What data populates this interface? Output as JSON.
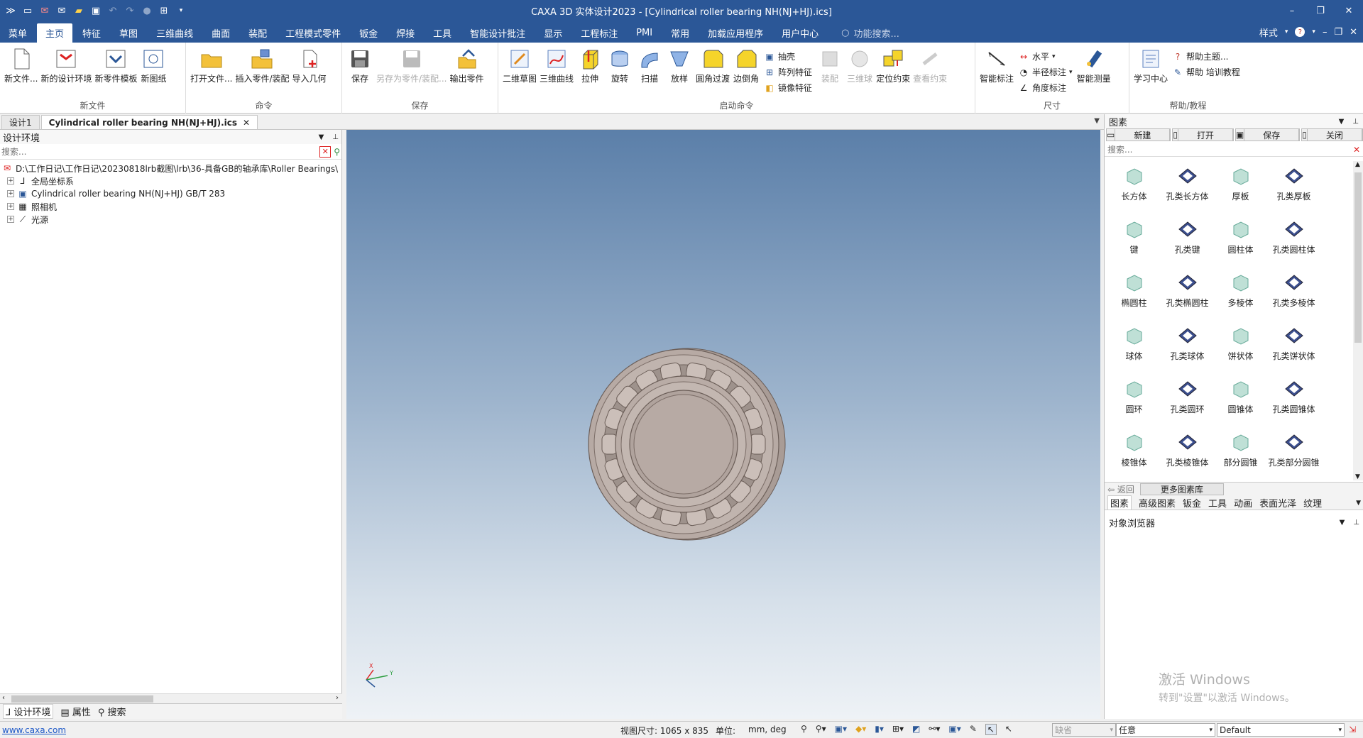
{
  "titlebar": {
    "title": "CAXA 3D 实体设计2023 - [Cylindrical roller bearing NH(NJ+HJ).ics]",
    "quick_access": [
      "app-logo-icon",
      "new-icon",
      "open-red-icon",
      "mail-icon",
      "folder-icon",
      "save-icon",
      "undo-icon",
      "redo-icon",
      "circle-icon",
      "grid-icon",
      "dropdown-icon"
    ],
    "window_controls": [
      "minimize-icon",
      "restore-icon",
      "close-icon"
    ]
  },
  "menubar": {
    "tabs": [
      "菜单",
      "主页",
      "特征",
      "草图",
      "三维曲线",
      "曲面",
      "装配",
      "工程模式零件",
      "钣金",
      "焊接",
      "工具",
      "智能设计批注",
      "显示",
      "工程标注",
      "PMI",
      "常用",
      "加载应用程序",
      "用户中心"
    ],
    "active": "主页",
    "search_placeholder": "功能搜索...",
    "style_label": "样式"
  },
  "ribbon": {
    "groups": [
      {
        "label": "新文件",
        "buttons": [
          "新文件...",
          "新的设计环境",
          "新零件模板",
          "新图纸"
        ]
      },
      {
        "label": "命令",
        "buttons": [
          "打开文件...",
          "插入零件/装配",
          "导入几何"
        ]
      },
      {
        "label": "保存",
        "buttons": [
          "保存",
          "另存为零件/装配...",
          "输出零件"
        ]
      },
      {
        "label": "启动命令",
        "buttons": [
          "二维草图",
          "三维曲线",
          "拉伸",
          "旋转",
          "扫描",
          "放样",
          "圆角过渡",
          "边倒角"
        ],
        "small": [
          "抽壳",
          "阵列特征",
          "镜像特征"
        ],
        "buttons2": [
          "装配",
          "三维球",
          "定位约束",
          "查看约束"
        ]
      },
      {
        "label": "尺寸",
        "buttons": [
          "智能标注"
        ],
        "small": [
          "水平",
          "半径标注",
          "角度标注"
        ],
        "buttons2": [
          "智能测量"
        ]
      },
      {
        "label": "帮助/教程",
        "buttons": [
          "学习中心"
        ],
        "small": [
          "帮助主题...",
          "帮助 培训教程"
        ]
      }
    ]
  },
  "doctabs": [
    "设计1",
    "Cylindrical roller bearing NH(NJ+HJ).ics"
  ],
  "leftpanel": {
    "title": "设计环境",
    "search_placeholder": "搜索...",
    "tree": [
      "D:\\工作日记\\工作日记\\20230818lrb截图\\lrb\\36-具备GB的轴承库\\Roller Bearings\\",
      "全局坐标系",
      "Cylindrical roller bearing NH(NJ+HJ) GB/T 283",
      "照相机",
      "光源"
    ],
    "bottom_tabs": [
      "设计环境",
      "属性",
      "搜索"
    ]
  },
  "rightpanel": {
    "title": "图素",
    "toolbar": [
      "新建",
      "打开",
      "保存",
      "关闭"
    ],
    "search_placeholder": "搜索...",
    "shapes": [
      "长方体",
      "孔类长方体",
      "厚板",
      "孔类厚板",
      "键",
      "孔类键",
      "圆柱体",
      "孔类圆柱体",
      "椭圆柱",
      "孔类椭圆柱",
      "多棱体",
      "孔类多棱体",
      "球体",
      "孔类球体",
      "饼状体",
      "孔类饼状体",
      "圆环",
      "孔类圆环",
      "圆锥体",
      "孔类圆锥体",
      "棱锥体",
      "孔类棱锥体",
      "部分圆锥",
      "孔类部分圆锥"
    ],
    "back_label": "返回",
    "more_label": "更多图素库",
    "category_tabs": [
      "图素",
      "高级图素",
      "钣金",
      "工具",
      "动画",
      "表面光泽",
      "纹理"
    ],
    "object_browser": "对象浏览器",
    "watermark_title": "激活 Windows",
    "watermark_sub": "转到\"设置\"以激活 Windows。"
  },
  "statusbar": {
    "link": "www.caxa.com",
    "view_size": "视图尺寸: 1065 x  835",
    "unit_label": "单位:",
    "unit_value": "mm, deg",
    "select_mode": "缺省",
    "filter": "任意",
    "style": "Default"
  },
  "viewport": {
    "axis_x": "X",
    "axis_y": "Y"
  },
  "colors": {
    "chrome": "#2b5797",
    "bearing": "#b7aaa4",
    "bearing_edge": "#6b5e58"
  }
}
